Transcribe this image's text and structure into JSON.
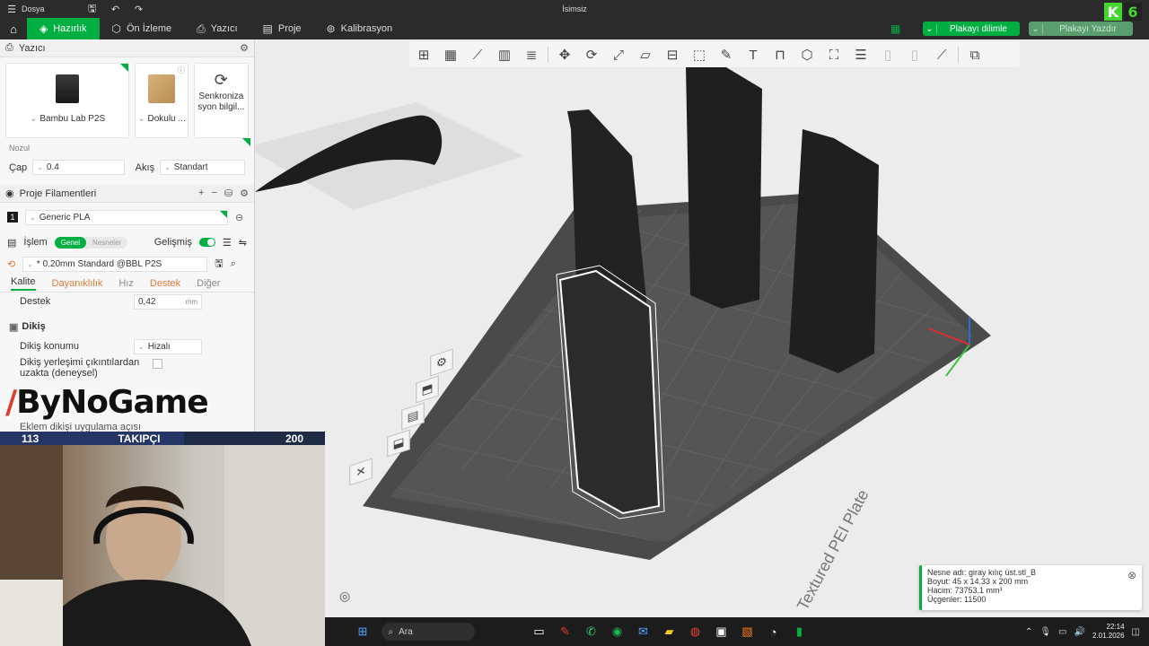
{
  "window": {
    "menu_label": "Dosya",
    "title": "İsimsiz",
    "minimize": "–",
    "close": "✕"
  },
  "tabs": [
    {
      "label": "Hazırlık",
      "icon": "tag-icon"
    },
    {
      "label": "Ön İzleme",
      "icon": "cube-icon"
    },
    {
      "label": "Yazıcı",
      "icon": "printer-icon"
    },
    {
      "label": "Proje",
      "icon": "document-icon"
    },
    {
      "label": "Kalibrasyon",
      "icon": "calibration-icon"
    }
  ],
  "actions": {
    "slice_label": "Plakayı dilimle",
    "print_label": "Plakayı Yazdır"
  },
  "brand_badge": {
    "k": "K",
    "six": "6"
  },
  "printer_section": {
    "title": "Yazıcı",
    "printer_name": "Bambu Lab P2S",
    "plate_name": "Dokulu ...",
    "sync_label_1": "Senkroniza",
    "sync_label_2": "syon bilgil..."
  },
  "nozzle": {
    "title": "Nozul",
    "diameter_label": "Çap",
    "diameter_value": "0.4",
    "flow_label": "Akış",
    "flow_value": "Standart"
  },
  "filaments": {
    "title": "Proje Filamentleri",
    "items": [
      {
        "index": "1",
        "name": "Generic PLA"
      }
    ]
  },
  "process": {
    "title": "İşlem",
    "seg_global": "Genel",
    "seg_objects": "Nesneler",
    "advanced_label": "Gelişmiş",
    "preset": "* 0.20mm Standard @BBL P2S",
    "tabs": [
      {
        "label": "Kalite",
        "state": "on"
      },
      {
        "label": "Dayanıklılık",
        "state": "warn"
      },
      {
        "label": "Hız",
        "state": ""
      },
      {
        "label": "Destek",
        "state": "warn"
      },
      {
        "label": "Diğer",
        "state": ""
      }
    ],
    "destek_label": "Destek",
    "destek_value": "0,42",
    "destek_unit": "mm",
    "seam_title": "Dikiş",
    "seam_position_label": "Dikiş konumu",
    "seam_position_value": "Hizalı",
    "seam_avoid_label_1": "Dikiş yerleşimi çıkıntılardan",
    "seam_avoid_label_2": "uzakta (deneysel)",
    "seam_gap_label": "Eklem dikişi uygulama açısı"
  },
  "overlay": {
    "brand": "ByNoGame",
    "follow_current": "113",
    "follow_label": "TAKIPÇI",
    "follow_goal": "200",
    "follow_progress": 0.565
  },
  "viewport": {
    "bed_label": "Textured PEI Plate"
  },
  "object_info": {
    "name": "Nesne adı: giray kılıç üst.stl_B",
    "size": "Boyut: 45 x 14.33 x 200 mm",
    "volume": "Hacim: 73753.1 mm³",
    "triangles": "Üçgenler: 11500"
  },
  "taskbar": {
    "search_label": "Ara",
    "time": "22:14",
    "date": "2.01.2026"
  }
}
